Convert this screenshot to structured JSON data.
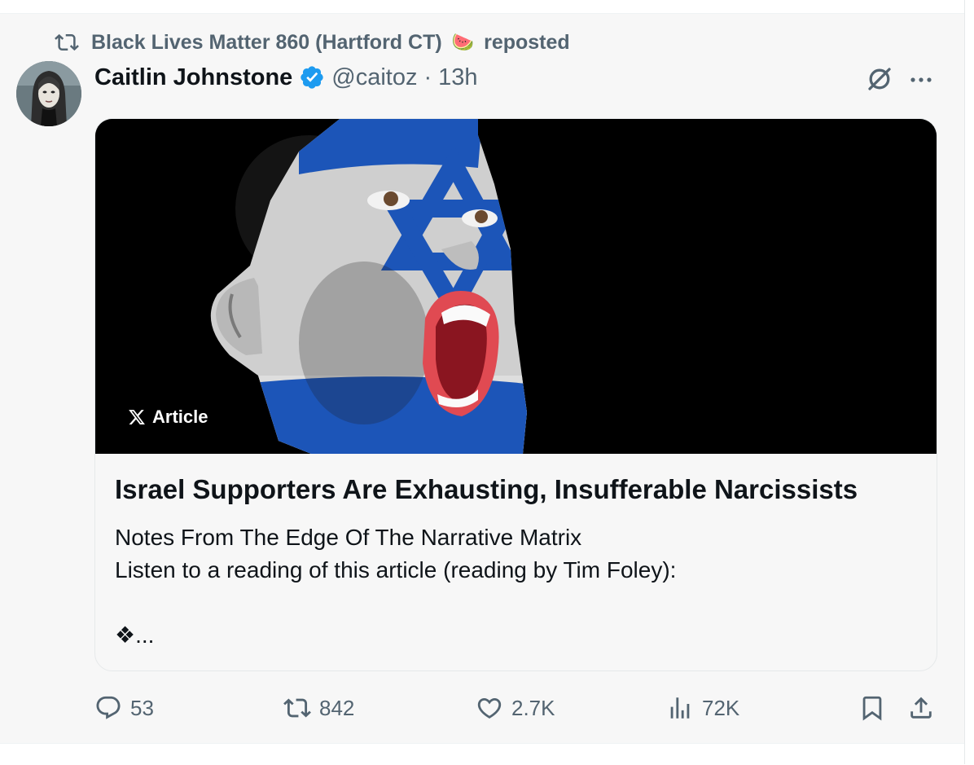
{
  "repost": {
    "user": "Black Lives Matter 860 (Hartford CT)",
    "emoji": "🍉",
    "suffix": "reposted"
  },
  "author": {
    "name": "Caitlin Johnstone",
    "handle": "@caitoz",
    "separator": "·",
    "time": "13h",
    "verified": true
  },
  "article": {
    "badge": "Article",
    "title": "Israel Supporters Are Exhausting, Insufferable Narcissists",
    "desc_line1": "Notes From The Edge Of The Narrative Matrix",
    "desc_line2": "Listen to a reading of this article (reading by Tim Foley):",
    "desc_line3": "❖..."
  },
  "actions": {
    "replies": "53",
    "reposts": "842",
    "likes": "2.7K",
    "views": "72K"
  },
  "colors": {
    "muted": "#536471",
    "verified": "#1d9bf0",
    "text": "#0f1419",
    "background": "#f7f7f7",
    "flag_blue": "#1c55b8"
  },
  "icons": [
    "repost-icon",
    "verified-icon",
    "grok-icon",
    "more-icon",
    "x-logo-icon",
    "reply-icon",
    "like-icon",
    "views-icon",
    "bookmark-icon",
    "share-icon"
  ]
}
